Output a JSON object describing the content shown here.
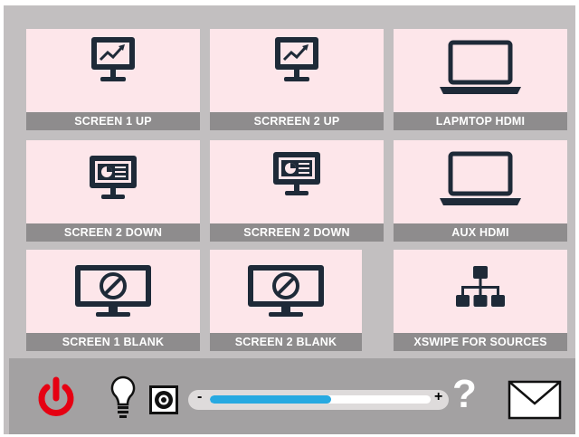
{
  "tiles": [
    {
      "label": "SCREEN  1 UP",
      "icon": "presentation-chart-icon"
    },
    {
      "label": "SCRREEN  2 UP",
      "icon": "presentation-chart-icon"
    },
    {
      "label": "LAPMTOP HDMI",
      "icon": "laptop-icon"
    },
    {
      "label": "SCREEN  2 DOWN",
      "icon": "dashboard-monitor-icon"
    },
    {
      "label": "SCRREEN  2 DOWN",
      "icon": "dashboard-monitor-icon"
    },
    {
      "label": "AUX HDMI",
      "icon": "laptop-icon"
    },
    {
      "label": "SCREEN 1 BLANK",
      "icon": "monitor-blocked-icon"
    },
    {
      "label": "SCREEN 2 BLANK",
      "icon": "monitor-blocked-icon"
    },
    {
      "label": "XSWIPE FOR SOURCES",
      "icon": "network-hierarchy-icon"
    }
  ],
  "controls": {
    "power_icon": "power-icon",
    "light_icon": "lightbulb-icon",
    "speaker_icon": "speaker-icon",
    "volume_minus": "-",
    "volume_plus": "+",
    "volume_level": 0.55,
    "help_label": "?",
    "mail_icon": "envelope-icon"
  },
  "colors": {
    "panel": "#c2bfc0",
    "tile": "#fde6ea",
    "label_bar": "#8e8c8d",
    "icon": "#1e2a38",
    "power": "#e60012",
    "volume": "#27a9e1"
  }
}
